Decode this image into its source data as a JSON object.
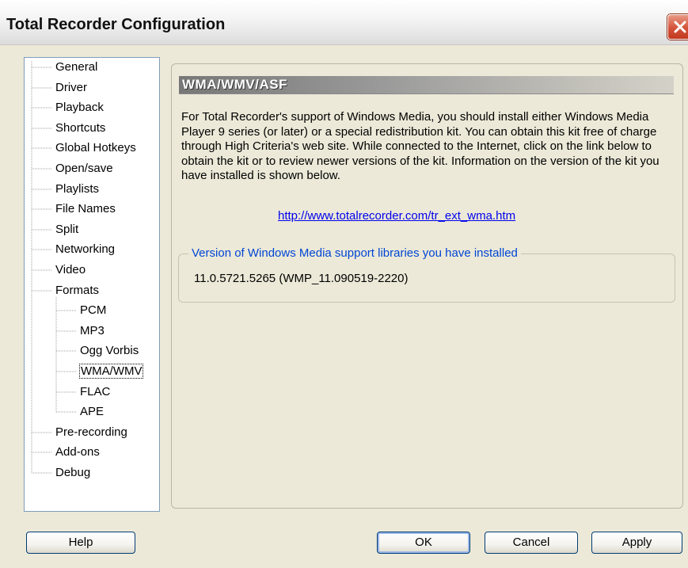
{
  "window": {
    "title": "Total Recorder Configuration"
  },
  "tree": {
    "items": [
      {
        "label": "General",
        "level": 0
      },
      {
        "label": "Driver",
        "level": 0
      },
      {
        "label": "Playback",
        "level": 0
      },
      {
        "label": "Shortcuts",
        "level": 0
      },
      {
        "label": "Global Hotkeys",
        "level": 0
      },
      {
        "label": "Open/save",
        "level": 0
      },
      {
        "label": "Playlists",
        "level": 0
      },
      {
        "label": "File Names",
        "level": 0
      },
      {
        "label": "Split",
        "level": 0
      },
      {
        "label": "Networking",
        "level": 0
      },
      {
        "label": "Video",
        "level": 0
      },
      {
        "label": "Formats",
        "level": 0
      },
      {
        "label": "PCM",
        "level": 1
      },
      {
        "label": "MP3",
        "level": 1
      },
      {
        "label": "Ogg Vorbis",
        "level": 1
      },
      {
        "label": "WMA/WMV",
        "level": 1,
        "selected": true
      },
      {
        "label": "FLAC",
        "level": 1
      },
      {
        "label": "APE",
        "level": 1
      },
      {
        "label": "Pre-recording",
        "level": 0
      },
      {
        "label": "Add-ons",
        "level": 0
      },
      {
        "label": "Debug",
        "level": 0
      }
    ]
  },
  "section": {
    "title": "WMA/WMV/ASF",
    "description": "For Total Recorder's support of Windows Media, you should install either Windows Media Player 9 series (or later) or a special redistribution kit. You can obtain this kit free of charge through High Criteria's web site. While connected to the Internet, click on the link below to obtain the kit or to review newer versions of the kit. Information on the version of the kit you have installed is shown below.",
    "link": "http://www.totalrecorder.com/tr_ext_wma.htm",
    "version_group_label": "Version of Windows Media support libraries you have installed",
    "version_value": "11.0.5721.5265 (WMP_11.090519-2220)"
  },
  "buttons": {
    "help": "Help",
    "ok": "OK",
    "cancel": "Cancel",
    "apply": "Apply"
  },
  "colors": {
    "window_bg": "#ece9d8",
    "link": "#0000ee",
    "group_label": "#0046d5",
    "close_button": "#d4533a"
  }
}
